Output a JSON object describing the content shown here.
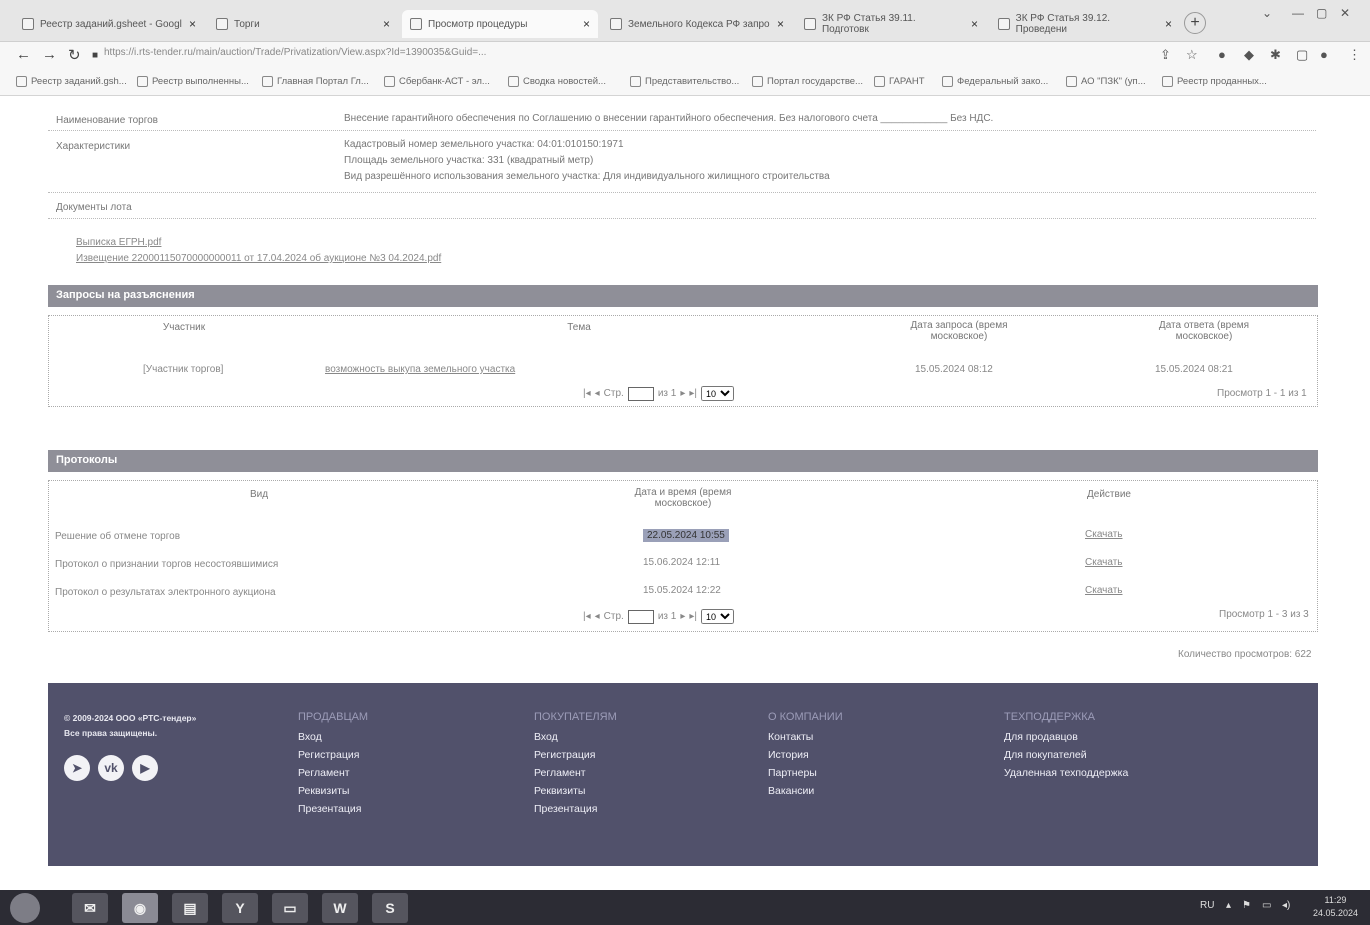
{
  "browser": {
    "tabs": [
      {
        "label": "Реестр заданий.gsheet - Googl"
      },
      {
        "label": "Торги"
      },
      {
        "label": "Просмотр процедуры"
      },
      {
        "label": "Земельного Кодекса РФ запро"
      },
      {
        "label": "ЗК РФ Статья 39.11. Подготовк"
      },
      {
        "label": "ЗК РФ Статья 39.12. Проведени"
      }
    ],
    "url": "https://i.rts-tender.ru/main/auction/Trade/Privatization/View.aspx?Id=1390035&Guid=...",
    "bookmarks": [
      "Реестр заданий.gsh...",
      "Реестр выполненны...",
      "Главная Портал Гл...",
      "Сбербанк-АСТ - эл...",
      "Сводка новостей...",
      "Представительство...",
      "Портал государстве...",
      "ГАРАНТ",
      "Федеральный зако...",
      "АО \"ПЗК\" (уп...",
      "Реестр проданных..."
    ]
  },
  "lot": {
    "name_label": "Наименование торгов",
    "name_value": "Внесение гарантийного обеспечения по Соглашению о внесении гарантийного обеспечения. Без налогового счета ____________ Без НДС.",
    "char_label": "Характеристики",
    "char_lines": [
      "Кадастровый номер земельного участка: 04:01:010150:1971",
      "Площадь земельного участка: 331 (квадратный метр)",
      "Вид разрешённого использования земельного участка: Для индивидуального жилищного строительства"
    ],
    "docs_label": "Документы лота",
    "docs": [
      "Выписка ЕГРН.pdf",
      "Извещение 22000115070000000011 от 17.04.2024 об аукционе №3 04.2024.pdf"
    ]
  },
  "requests": {
    "title": "Запросы на разъяснения",
    "columns": [
      "Участник",
      "Тема",
      "Дата запроса (время московское)",
      "Дата ответа (время московское)"
    ],
    "rows": [
      {
        "participant": "[Участник торгов]",
        "topic": "возможность выкупа земельного участка",
        "request_date": "15.05.2024 08:12",
        "answer_date": "15.05.2024 08:21"
      }
    ],
    "pager": {
      "page_label": "Стр.",
      "of": "из 1",
      "per_page": "10",
      "info": "Просмотр 1 - 1 из 1"
    }
  },
  "protocols": {
    "title": "Протоколы",
    "columns": [
      "Вид",
      "Дата и время (время московское)",
      "Действие"
    ],
    "rows": [
      {
        "kind": "Решение об отмене торгов",
        "datetime": "22.05.2024 10:55",
        "action": "Скачать"
      },
      {
        "kind": "Протокол о признании торгов несостоявшимися",
        "datetime": "15.06.2024 12:11",
        "action": "Скачать"
      },
      {
        "kind": "Протокол о результатах электронного аукциона",
        "datetime": "15.05.2024 12:22",
        "action": "Скачать"
      }
    ],
    "pager": {
      "page_label": "Стр.",
      "of": "из 1",
      "per_page": "10",
      "info": "Просмотр 1 - 3 из 3"
    }
  },
  "views": "Количество просмотров: 622",
  "footer": {
    "copyright": "© 2009-2024 ООО «РТС-тендер»",
    "rights": "Все права защищены.",
    "social": [
      "telegram-icon",
      "vk-icon",
      "youtube-icon"
    ],
    "columns": [
      {
        "title": "ПРОДАВЦАМ",
        "items": [
          "Вход",
          "Регистрация",
          "Регламент",
          "Реквизиты",
          "Презентация"
        ]
      },
      {
        "title": "ПОКУПАТЕЛЯМ",
        "items": [
          "Вход",
          "Регистрация",
          "Регламент",
          "Реквизиты",
          "Презентация"
        ]
      },
      {
        "title": "О КОМПАНИИ",
        "items": [
          "Контакты",
          "История",
          "Партнеры",
          "Вакансии"
        ]
      },
      {
        "title": "ТЕХПОДДЕРЖКА",
        "items": [
          "Для продавцов",
          "Для покупателей",
          "Удаленная техподдержка"
        ]
      }
    ]
  },
  "taskbar": {
    "lang": "RU",
    "time": "11:29",
    "date": "24.05.2024"
  }
}
